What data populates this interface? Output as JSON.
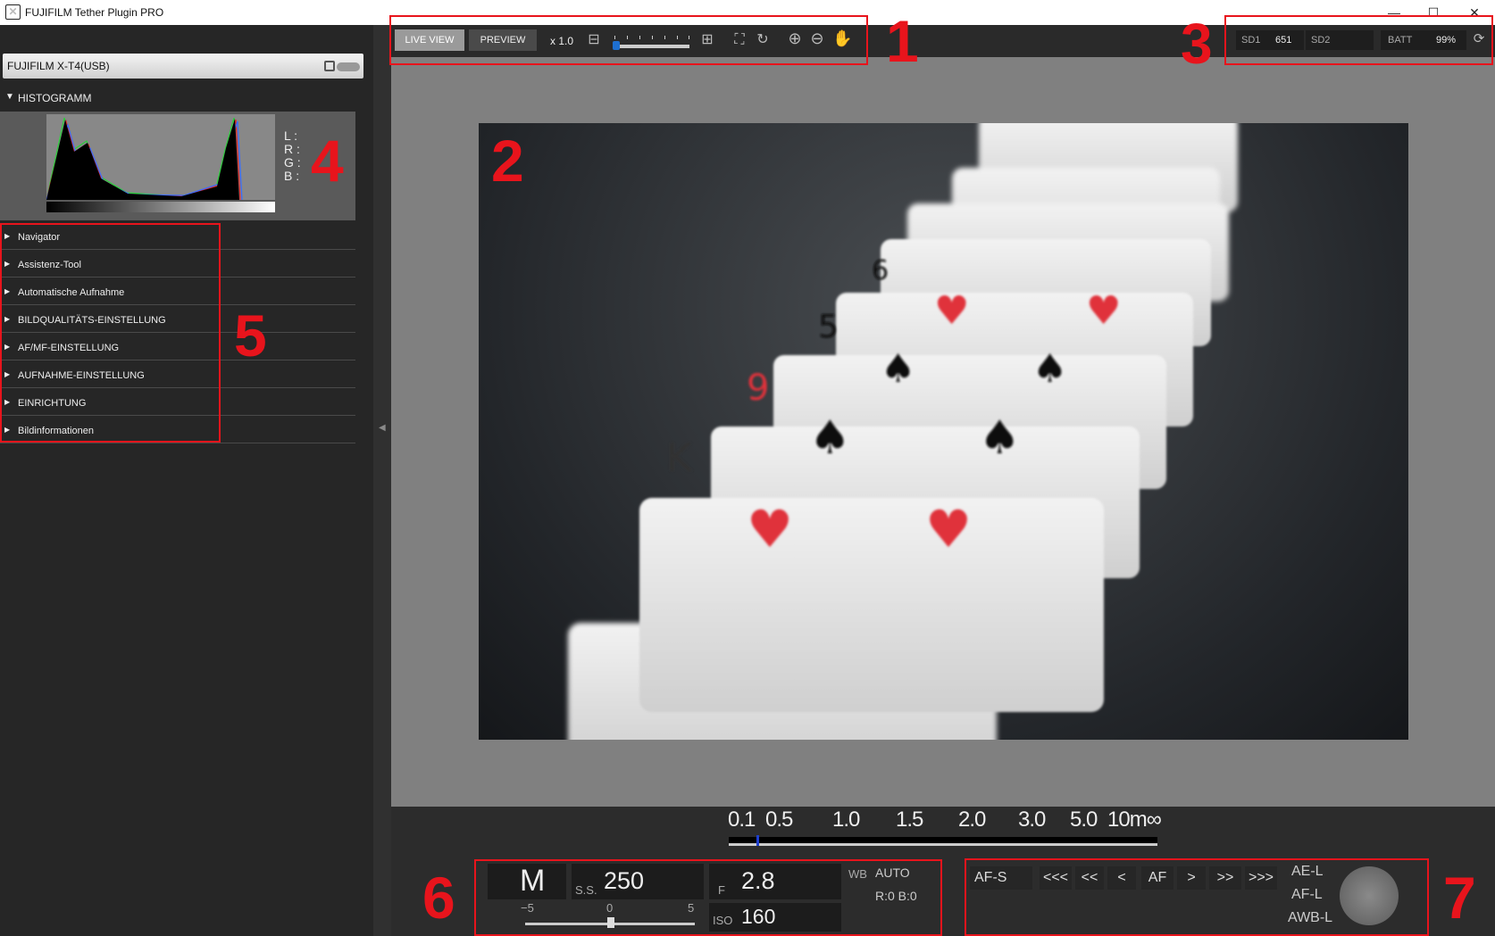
{
  "window": {
    "title": "FUJIFILM Tether Plugin PRO",
    "minimize": "—",
    "maximize": "☐",
    "close": "✕"
  },
  "sidebar": {
    "camera": "FUJIFILM X-T4(USB)",
    "histogram_title": "HISTOGRAMM",
    "histogram_channels": {
      "l": "L :",
      "r": "R :",
      "g": "G :",
      "b": "B :"
    },
    "items": [
      {
        "label": "Navigator"
      },
      {
        "label": "Assistenz-Tool"
      },
      {
        "label": "Automatische Aufnahme"
      },
      {
        "label": "BILDQUALITÄTS-EINSTELLUNG"
      },
      {
        "label": "AF/MF-EINSTELLUNG"
      },
      {
        "label": "AUFNAHME-EINSTELLUNG"
      },
      {
        "label": "EINRICHTUNG"
      },
      {
        "label": "Bildinformationen"
      }
    ]
  },
  "toolbar": {
    "live_view": "LIVE VIEW",
    "preview": "PREVIEW",
    "zoom": "x 1.0"
  },
  "status": {
    "sd1_label": "SD1",
    "sd1_value": "651",
    "sd2_label": "SD2",
    "batt_label": "BATT",
    "batt_value": "99%"
  },
  "focus_scale": [
    "0.1",
    "0.5",
    "1.0",
    "1.5",
    "2.0",
    "3.0",
    "5.0",
    "10m∞"
  ],
  "exposure": {
    "mode": "M",
    "ss_label": "S.S.",
    "ss_value": "250",
    "f_label": "F",
    "f_value": "2.8",
    "iso_label": "ISO",
    "iso_value": "160",
    "wb_label": "WB",
    "wb_value": "AUTO",
    "wb_shift": "R:0 B:0",
    "ev_min": "−5",
    "ev_zero": "0",
    "ev_max": "5"
  },
  "af": {
    "mode": "AF-S",
    "b1": "<<<",
    "b2": "<<",
    "b3": "<",
    "af": "AF",
    "b4": ">",
    "b5": ">>",
    "b6": ">>>",
    "ae_l": "AE-L",
    "af_l": "AF-L",
    "awb_l": "AWB-L"
  },
  "annotations": [
    "1",
    "2",
    "3",
    "4",
    "5",
    "6",
    "7"
  ]
}
